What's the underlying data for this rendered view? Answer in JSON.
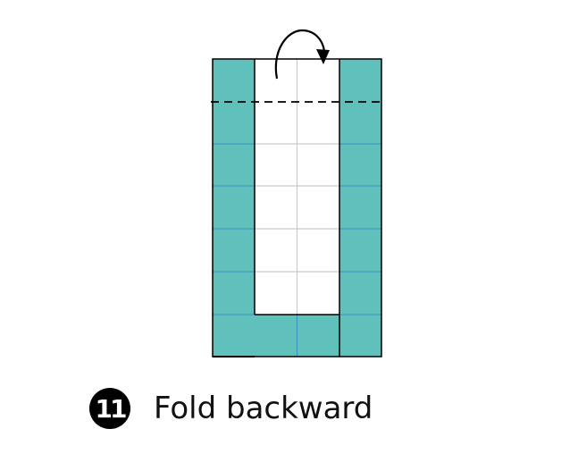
{
  "step": {
    "number": "11",
    "instruction": "Fold backward"
  },
  "colors": {
    "teal": "#60c0bb",
    "grid_line": "#c9c9c9",
    "teal_grid_line": "#3d8fbf",
    "outline": "#000000",
    "fold_line": "#000000",
    "arrow": "#000000"
  },
  "diagram": {
    "grid_columns": 4,
    "grid_rows": 7,
    "fold_line_style": "dashed",
    "arrow_direction": "backward"
  }
}
